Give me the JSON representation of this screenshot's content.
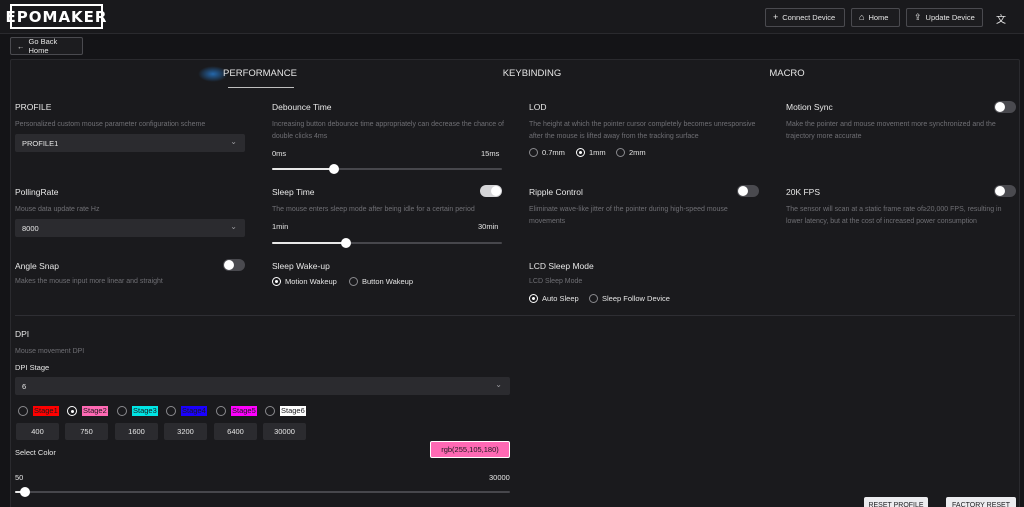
{
  "header": {
    "logo": "EPOMAKER",
    "connect_label": "Connect Device",
    "home_label": "Home",
    "update_label": "Update Device",
    "language_icon": "translate-icon"
  },
  "back_label": "Go Back Home",
  "tabs": [
    "PERFORMANCE",
    "KEYBINDING",
    "MACRO"
  ],
  "active_tab": "PERFORMANCE",
  "profile": {
    "title": "PROFILE",
    "desc": "Personalized custom mouse parameter configuration scheme",
    "value": "PROFILE1"
  },
  "debounce": {
    "title": "Debounce Time",
    "desc": "Increasing button debounce time appropriately can decrease the chance of double clicks 4ms",
    "min": "0ms",
    "max": "15ms",
    "level": 0.27
  },
  "lod": {
    "title": "LOD",
    "desc": "The height at which the pointer cursor completely becomes unresponsive after the mouse is lifted away from the tracking surface",
    "options": [
      "0.7mm",
      "1mm",
      "2mm"
    ],
    "selected": "1mm"
  },
  "motion_sync": {
    "title": "Motion Sync",
    "desc": "Make the pointer and mouse movement more synchronized and the trajectory more accurate",
    "on": false
  },
  "polling": {
    "title": "PollingRate",
    "desc": "Mouse data update rate Hz",
    "value": "8000"
  },
  "sleep_time": {
    "title": "Sleep Time",
    "desc": "The mouse enters sleep mode after being idle for a certain period",
    "min": "1min",
    "max": "30min",
    "level": 0.32,
    "on": true
  },
  "ripple": {
    "title": "Ripple Control",
    "desc": "Eliminate wave-like jitter of the pointer during high-speed mouse movements",
    "on": false
  },
  "fps20k": {
    "title": "20K FPS",
    "desc": "The sensor will scan at a static frame rate of≥20,000 FPS, resulting in lower latency, but at the cost of increased power consumption",
    "on": false
  },
  "angle_snap": {
    "title": "Angle Snap",
    "desc": "Makes the mouse input more linear and straight",
    "on": false
  },
  "sleep_wakeup": {
    "title": "Sleep Wake-up",
    "options": [
      "Motion Wakeup",
      "Button Wakeup"
    ],
    "selected": "Motion Wakeup"
  },
  "lcd": {
    "title": "LCD Sleep Mode",
    "desc": "LCD Sleep Mode",
    "options": [
      "Auto Sleep",
      "Sleep Follow Device"
    ],
    "selected": "Auto Sleep"
  },
  "dpi": {
    "title": "DPI",
    "desc": "Mouse movement DPI",
    "stage_label": "DPI Stage",
    "stage_value": "6",
    "stages": [
      {
        "label": "Stage1",
        "color": "#ff0000",
        "text_color": "#1a1a1d",
        "value": "400"
      },
      {
        "label": "Stage2",
        "color": "#ff69b4",
        "text_color": "#1a1a1d",
        "value": "750"
      },
      {
        "label": "Stage3",
        "color": "#00e5e5",
        "text_color": "#1a1a1d",
        "value": "1600"
      },
      {
        "label": "Stage4",
        "color": "#1a00ff",
        "text_color": "#1a1a1d",
        "value": "3200"
      },
      {
        "label": "Stage5",
        "color": "#ff00ff",
        "text_color": "#1a1a1d",
        "value": "6400"
      },
      {
        "label": "Stage6",
        "color": "#ffffff",
        "text_color": "#1a1a1d",
        "value": "30000"
      }
    ],
    "selected_stage": "Stage2",
    "color_label": "Select Color",
    "color_value": "rgb(255,105,180)",
    "color_hex": "#ff69b4",
    "range_min": "50",
    "range_max": "30000",
    "level": 0.02
  },
  "bottom": {
    "reset_profile": "RESET PROFILE",
    "factory_reset": "FACTORY RESET"
  }
}
